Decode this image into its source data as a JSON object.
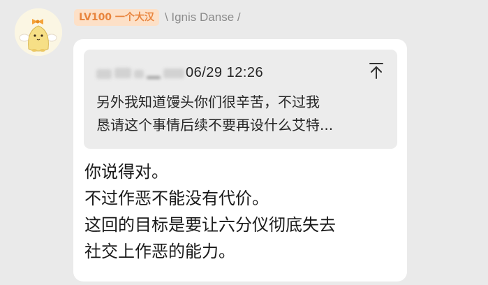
{
  "sender": {
    "level_badge": "LV100 一个大汉",
    "name": "\\ Ignis Danse /",
    "avatar_icon": "sumikko-character-avatar-icon"
  },
  "quote": {
    "time": "06/29 12:26",
    "lines": [
      "另外我知道馒头你们很辛苦，不过我",
      "恳请这个事情后续不要再设什么艾特..."
    ],
    "jump_icon": "jump-to-top-icon"
  },
  "message": {
    "lines": [
      "你说得对。",
      "不过作恶不能没有代价。",
      "这回的目标是要让六分仪彻底失去",
      "社交上作恶的能力。"
    ]
  },
  "colors": {
    "background": "#eaeaea",
    "bubble": "#ffffff",
    "quote_card": "#ececec",
    "level_badge_bg": "#fde0c7",
    "level_badge_text": "#e8843d",
    "name_text": "#8b8b8b"
  }
}
